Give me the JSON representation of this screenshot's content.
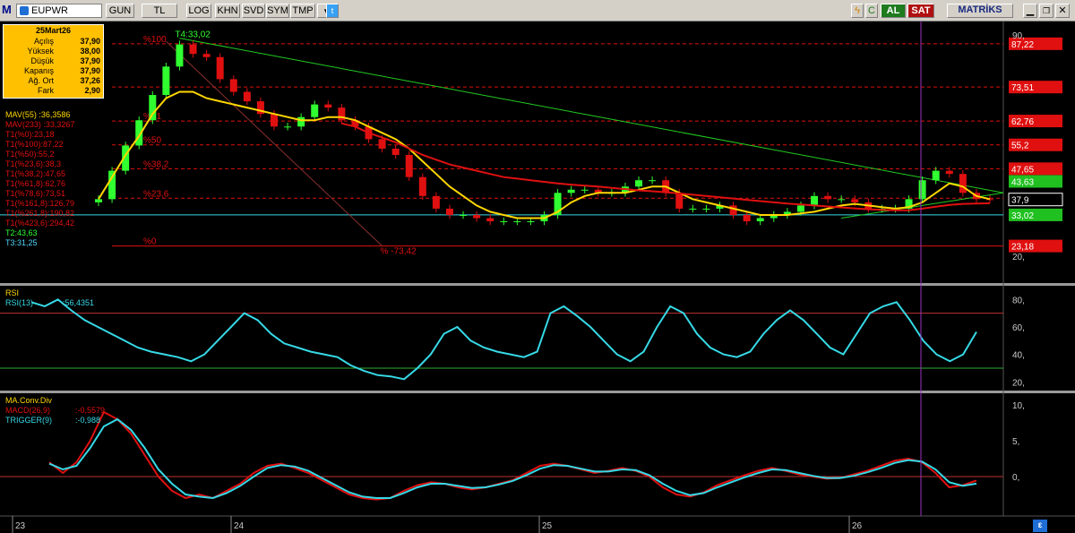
{
  "toolbar": {
    "symbol": "EUPWR",
    "buttons": [
      "GUN",
      "TL",
      "LOG",
      "KHN",
      "SVD",
      "SYM",
      "TMP"
    ],
    "buy_label": "AL",
    "sell_label": "SAT",
    "brand": "MATRİKS"
  },
  "info_box": {
    "date": "25Mart26",
    "rows": [
      {
        "label": "Açılış",
        "value": "37,90"
      },
      {
        "label": "Yüksek",
        "value": "38,00"
      },
      {
        "label": "Düşük",
        "value": "37,90"
      },
      {
        "label": "Kapanış",
        "value": "37,90"
      },
      {
        "label": "Ağ. Ort",
        "value": "37,26"
      },
      {
        "label": "Fark",
        "value": "2,90"
      }
    ]
  },
  "price_legend": [
    {
      "label": "MAV(55)",
      "value": ":36,3586",
      "color": "#ffd700"
    },
    {
      "label": "MAV(233)",
      "value": ":33,3267",
      "color": "#e01010"
    },
    {
      "label": "T1(%0):23,18",
      "value": "",
      "color": "#e01010"
    },
    {
      "label": "T1(%100):87,22",
      "value": "",
      "color": "#e01010"
    },
    {
      "label": "T1(%50):55,2",
      "value": "",
      "color": "#e01010"
    },
    {
      "label": "T1(%23,6):38,3",
      "value": "",
      "color": "#e01010"
    },
    {
      "label": "T1(%38,2):47,65",
      "value": "",
      "color": "#e01010"
    },
    {
      "label": "T1(%61,8):62,76",
      "value": "",
      "color": "#e01010"
    },
    {
      "label": "T1(%78,6):73,51",
      "value": "",
      "color": "#e01010"
    },
    {
      "label": "T1(%161,8):126,79",
      "value": "",
      "color": "#e01010"
    },
    {
      "label": "T1(%261,8):190,82",
      "value": "",
      "color": "#e01010"
    },
    {
      "label": "T1(%423,6):294,42",
      "value": "",
      "color": "#e01010"
    },
    {
      "label": "T2:43,63",
      "value": "",
      "color": "#30ff30"
    },
    {
      "label": "T3:31,25",
      "value": "",
      "color": "#4fd8ff"
    }
  ],
  "annotations": {
    "t4_label": "T4:33,02",
    "pct50": "%50",
    "pct382": "%38,2",
    "pct236": "%23,6",
    "pct0": "%0",
    "pct618": "%61",
    "pct100": "%100",
    "diag_label": "% -73,42"
  },
  "rsi_legend": {
    "title": "RSI",
    "label": "RSI(13)",
    "value": ":56,4351"
  },
  "macd_legend": {
    "title": "MA.Conv.Div",
    "macd_label": "MACD(26,9)",
    "macd_value": ":-0,5579",
    "trigger_label": "TRIGGER(9)",
    "trigger_value": ":-0,988"
  },
  "colors": {
    "up": "#30ff30",
    "down": "#e01010",
    "mav55": "#ffd700",
    "mav233": "#e01010",
    "fib": "#e01010",
    "trend": "#22cc22",
    "support": "#36d9e6",
    "rsi": "#36d9e6",
    "macd": "#e01010",
    "trigger": "#36d9e6",
    "cursor": "#9b30c0"
  },
  "chart_data": [
    {
      "type": "candlestick",
      "title": "EUPWR",
      "xlabel": "",
      "ylabel": "",
      "x_ticks": [
        "23",
        "24",
        "25",
        "26"
      ],
      "y_ticks": [
        90,
        20
      ],
      "ylim": [
        12,
        92
      ],
      "last_price": 37.9,
      "close_series": [
        38,
        47,
        55,
        63,
        71,
        80,
        87,
        84,
        83,
        76,
        72,
        69,
        65,
        61,
        61,
        64,
        68,
        67,
        63,
        61,
        57,
        54,
        52,
        45,
        39,
        35,
        33,
        33,
        32,
        31,
        31,
        31,
        31,
        33,
        40,
        41,
        41,
        40,
        40,
        42,
        44,
        44,
        40,
        35,
        35,
        35,
        36,
        33,
        31,
        32,
        33,
        34,
        36,
        39,
        38,
        38,
        37,
        35,
        35,
        35,
        38,
        44,
        47,
        46,
        40,
        38,
        37.9
      ],
      "fibonacci_levels": [
        {
          "label": "87,22",
          "value": 87.22,
          "pct": "%100"
        },
        {
          "label": "73,51",
          "value": 73.51,
          "pct": "%78,6"
        },
        {
          "label": "62,76",
          "value": 62.76,
          "pct": "%61,8"
        },
        {
          "label": "55,2",
          "value": 55.2,
          "pct": "%50"
        },
        {
          "label": "47,65",
          "value": 47.65,
          "pct": "%38,2"
        },
        {
          "label": "38,3",
          "value": 38.3,
          "pct": "%23,6"
        },
        {
          "label": "23,18",
          "value": 23.18,
          "pct": "%0"
        }
      ],
      "price_tags": [
        {
          "label": "87,22",
          "value": 87.22,
          "color": "#e01010"
        },
        {
          "label": "73,51",
          "value": 73.51,
          "color": "#e01010"
        },
        {
          "label": "62,76",
          "value": 62.76,
          "color": "#e01010"
        },
        {
          "label": "55,2",
          "value": 55.2,
          "color": "#e01010"
        },
        {
          "label": "47,65",
          "value": 47.65,
          "color": "#e01010"
        },
        {
          "label": "43,63",
          "value": 43.63,
          "color": "#20c020"
        },
        {
          "label": "37,9",
          "value": 37.9,
          "color": "#000000"
        },
        {
          "label": "33,02",
          "value": 33.02,
          "color": "#20c020"
        },
        {
          "label": "23,18",
          "value": 23.18,
          "color": "#e01010"
        }
      ],
      "support_level": 33.02,
      "series": [
        {
          "name": "MAV(55)",
          "values": [
            38,
            45,
            52,
            58,
            65,
            70,
            72,
            72,
            70,
            69,
            68,
            67,
            66,
            65,
            64,
            63,
            63,
            64,
            64,
            63,
            61,
            59,
            57,
            54,
            50,
            46,
            42,
            39,
            36,
            34,
            33,
            32,
            32,
            32,
            34,
            37,
            39,
            40,
            40,
            40,
            41,
            42,
            42,
            40,
            38,
            37,
            36,
            35,
            34,
            33,
            33,
            33,
            33.5,
            34,
            35,
            36,
            36.5,
            36,
            35.5,
            35,
            35.5,
            37,
            40,
            43,
            42,
            39,
            38
          ]
        },
        {
          "name": "MAV(233)",
          "values": [
            null,
            null,
            null,
            null,
            null,
            null,
            null,
            null,
            null,
            null,
            null,
            null,
            null,
            null,
            null,
            null,
            null,
            null,
            62,
            61,
            59,
            57.5,
            56,
            54,
            52,
            50.5,
            49,
            48,
            47,
            46,
            45,
            44.5,
            44,
            43.5,
            43,
            42.6,
            42.3,
            42,
            41.6,
            41.2,
            40.8,
            40.5,
            40.2,
            39.8,
            39.4,
            39,
            38.6,
            38.2,
            37.8,
            37.4,
            37,
            36.6,
            36.3,
            36,
            35.7,
            35.4,
            35.1,
            34.8,
            34.6,
            34.5,
            34.5,
            35,
            35.6,
            36.2,
            36.5,
            36.6,
            36.7
          ]
        }
      ]
    },
    {
      "type": "line",
      "title": "RSI",
      "y_ticks": [
        80,
        60,
        40,
        20
      ],
      "ylim": [
        15,
        88
      ],
      "levels": [
        70,
        30
      ],
      "series": [
        {
          "name": "RSI(13)",
          "values": [
            78,
            75,
            80,
            72,
            65,
            60,
            55,
            50,
            45,
            42,
            40,
            38,
            35,
            40,
            50,
            60,
            70,
            65,
            55,
            48,
            45,
            42,
            40,
            38,
            32,
            28,
            25,
            24,
            22,
            30,
            40,
            55,
            60,
            50,
            45,
            42,
            40,
            38,
            42,
            70,
            75,
            68,
            60,
            50,
            40,
            35,
            42,
            60,
            75,
            70,
            55,
            45,
            40,
            38,
            42,
            55,
            65,
            72,
            65,
            55,
            45,
            40,
            55,
            70,
            75,
            78,
            65,
            50,
            40,
            35,
            40,
            56.4
          ]
        }
      ]
    },
    {
      "type": "line",
      "title": "MA.Conv.Div",
      "y_ticks": [
        10,
        5,
        0
      ],
      "ylim": [
        -5,
        11
      ],
      "series": [
        {
          "name": "MACD(26,9)",
          "values": [
            2,
            0.5,
            2,
            5,
            9,
            8,
            6,
            3,
            0,
            -2,
            -3,
            -2.5,
            -3,
            -2,
            -1,
            0.5,
            1.5,
            1.8,
            1.2,
            0.5,
            -0.5,
            -1.5,
            -2.5,
            -3,
            -3.2,
            -3,
            -2,
            -1.2,
            -0.8,
            -1,
            -1.5,
            -1.8,
            -1.5,
            -1,
            -0.5,
            0.5,
            1.5,
            1.8,
            1.5,
            1,
            0.5,
            0.8,
            1.2,
            0.8,
            0,
            -1.5,
            -2.5,
            -2.8,
            -2.2,
            -1.2,
            -0.5,
            0.2,
            0.8,
            1.2,
            0.8,
            0.3,
            0,
            -0.3,
            -0.2,
            0.3,
            0.8,
            1.5,
            2.2,
            2.5,
            2,
            0.5,
            -1.5,
            -1.2,
            -0.56
          ]
        },
        {
          "name": "TRIGGER(9)",
          "values": [
            1.8,
            1,
            1.5,
            4,
            7,
            8,
            6.5,
            4,
            1,
            -1,
            -2.5,
            -2.8,
            -3,
            -2.3,
            -1.3,
            0,
            1.2,
            1.6,
            1.4,
            0.8,
            -0.2,
            -1.2,
            -2.2,
            -2.8,
            -3,
            -3,
            -2.3,
            -1.5,
            -1,
            -1,
            -1.3,
            -1.6,
            -1.5,
            -1.1,
            -0.6,
            0.2,
            1.1,
            1.6,
            1.5,
            1.1,
            0.7,
            0.7,
            1,
            0.9,
            0.2,
            -1,
            -2,
            -2.6,
            -2.3,
            -1.5,
            -0.8,
            -0.1,
            0.5,
            1,
            0.9,
            0.5,
            0.1,
            -0.2,
            -0.2,
            0.1,
            0.6,
            1.2,
            1.9,
            2.3,
            2.1,
            1,
            -0.8,
            -1.3,
            -0.99
          ]
        }
      ]
    }
  ]
}
